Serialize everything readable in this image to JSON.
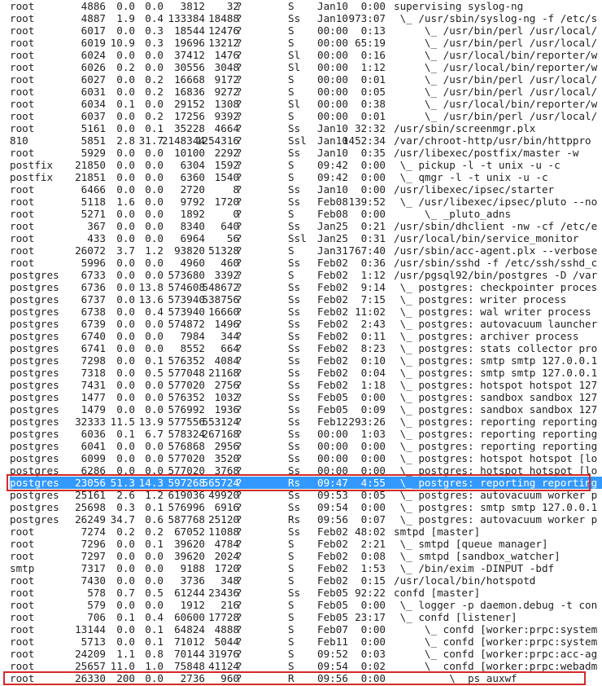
{
  "process_list": {
    "selected_pid": "23056",
    "rows": [
      {
        "user": "root",
        "pid": "4886",
        "cpu": "0.0",
        "mem": "0.0",
        "vsz": "3812",
        "rss": "32",
        "tty": "?",
        "stat": "S",
        "start": "Jan10",
        "time": "0:00",
        "cmd": "supervising syslog-ng"
      },
      {
        "user": "root",
        "pid": "4887",
        "cpu": "1.9",
        "mem": "0.4",
        "vsz": "133384",
        "rss": "18488",
        "tty": "?",
        "stat": "Ss",
        "start": "Jan10",
        "time": "973:07",
        "cmd": " \\_ /usr/sbin/syslog-ng -f /etc/s"
      },
      {
        "user": "root",
        "pid": "6017",
        "cpu": "0.0",
        "mem": "0.3",
        "vsz": "18544",
        "rss": "12476",
        "tty": "?",
        "stat": "S",
        "start": "00:00",
        "time": "0:13",
        "cmd": "     \\_ /usr/bin/perl /usr/local/"
      },
      {
        "user": "root",
        "pid": "6019",
        "cpu": "10.9",
        "mem": "0.3",
        "vsz": "19696",
        "rss": "13212",
        "tty": "?",
        "stat": "S",
        "start": "00:00",
        "time": "65:19",
        "cmd": "     \\_ /usr/bin/perl /usr/local/"
      },
      {
        "user": "root",
        "pid": "6024",
        "cpu": "0.0",
        "mem": "0.0",
        "vsz": "37412",
        "rss": "1476",
        "tty": "?",
        "stat": "Sl",
        "start": "00:00",
        "time": "0:16",
        "cmd": "     \\_ /usr/local/bin/reporter/w"
      },
      {
        "user": "root",
        "pid": "6026",
        "cpu": "0.2",
        "mem": "0.0",
        "vsz": "30556",
        "rss": "3048",
        "tty": "?",
        "stat": "Sl",
        "start": "00:00",
        "time": "1:12",
        "cmd": "     \\_ /usr/local/bin/reporter/w"
      },
      {
        "user": "root",
        "pid": "6027",
        "cpu": "0.0",
        "mem": "0.2",
        "vsz": "16668",
        "rss": "9172",
        "tty": "?",
        "stat": "S",
        "start": "00:00",
        "time": "0:01",
        "cmd": "     \\_ /usr/bin/perl /usr/local/"
      },
      {
        "user": "root",
        "pid": "6031",
        "cpu": "0.0",
        "mem": "0.2",
        "vsz": "16836",
        "rss": "9272",
        "tty": "?",
        "stat": "S",
        "start": "00:00",
        "time": "0:05",
        "cmd": "     \\_ /usr/bin/perl /usr/local/"
      },
      {
        "user": "root",
        "pid": "6034",
        "cpu": "0.1",
        "mem": "0.0",
        "vsz": "29152",
        "rss": "1308",
        "tty": "?",
        "stat": "Sl",
        "start": "00:00",
        "time": "0:38",
        "cmd": "     \\_ /usr/local/bin/reporter/w"
      },
      {
        "user": "root",
        "pid": "6037",
        "cpu": "0.0",
        "mem": "0.2",
        "vsz": "17256",
        "rss": "9392",
        "tty": "?",
        "stat": "S",
        "start": "00:00",
        "time": "0:01",
        "cmd": "     \\_ /usr/bin/perl /usr/local/"
      },
      {
        "user": "root",
        "pid": "5161",
        "cpu": "0.0",
        "mem": "0.1",
        "vsz": "35228",
        "rss": "4664",
        "tty": "?",
        "stat": "Ss",
        "start": "Jan10",
        "time": "32:32",
        "cmd": "/usr/sbin/screenmgr.plx"
      },
      {
        "user": "810",
        "pid": "5851",
        "cpu": "2.8",
        "mem": "31.7",
        "vsz": "2148344",
        "rss": "1254316",
        "tty": "?",
        "stat": "Ssl",
        "start": "Jan10",
        "time": "1452:34",
        "cmd": "/var/chroot-http/usr/bin/httppro"
      },
      {
        "user": "root",
        "pid": "5929",
        "cpu": "0.0",
        "mem": "0.0",
        "vsz": "10100",
        "rss": "2292",
        "tty": "?",
        "stat": "Ss",
        "start": "Jan10",
        "time": "0:35",
        "cmd": "/usr/libexec/postfix/master -w"
      },
      {
        "user": "postfix",
        "pid": "21850",
        "cpu": "0.0",
        "mem": "0.0",
        "vsz": "6304",
        "rss": "1592",
        "tty": "?",
        "stat": "S",
        "start": "09:42",
        "time": "0:00",
        "cmd": " \\_ pickup -l -t unix -u -c"
      },
      {
        "user": "postfix",
        "pid": "21851",
        "cpu": "0.0",
        "mem": "0.0",
        "vsz": "6360",
        "rss": "1540",
        "tty": "?",
        "stat": "S",
        "start": "09:42",
        "time": "0:00",
        "cmd": " \\_ qmgr -l -t unix -u -c"
      },
      {
        "user": "root",
        "pid": "6466",
        "cpu": "0.0",
        "mem": "0.0",
        "vsz": "2720",
        "rss": "8",
        "tty": "?",
        "stat": "Ss",
        "start": "Jan10",
        "time": "0:00",
        "cmd": "/usr/libexec/ipsec/starter"
      },
      {
        "user": "root",
        "pid": "5118",
        "cpu": "1.6",
        "mem": "0.0",
        "vsz": "9792",
        "rss": "1720",
        "tty": "?",
        "stat": "Ss",
        "start": "Feb08",
        "time": "139:52",
        "cmd": " \\_ /usr/libexec/ipsec/pluto --no"
      },
      {
        "user": "root",
        "pid": "5271",
        "cpu": "0.0",
        "mem": "0.0",
        "vsz": "1892",
        "rss": "0",
        "tty": "?",
        "stat": "S",
        "start": "Feb08",
        "time": "0:00",
        "cmd": "     \\_ _pluto_adns"
      },
      {
        "user": "root",
        "pid": "367",
        "cpu": "0.0",
        "mem": "0.0",
        "vsz": "8340",
        "rss": "640",
        "tty": "?",
        "stat": "Ss",
        "start": "Jan25",
        "time": "0:21",
        "cmd": "/usr/sbin/dhclient -nw -cf /etc/e"
      },
      {
        "user": "root",
        "pid": "433",
        "cpu": "0.0",
        "mem": "0.0",
        "vsz": "6964",
        "rss": "56",
        "tty": "?",
        "stat": "Ssl",
        "start": "Jan25",
        "time": "0:31",
        "cmd": "/usr/local/bin/service_monitor"
      },
      {
        "user": "root",
        "pid": "26072",
        "cpu": "3.7",
        "mem": "1.2",
        "vsz": "93820",
        "rss": "51328",
        "tty": "?",
        "stat": "S",
        "start": "Jan31",
        "time": "767:40",
        "cmd": "/usr/sbin/acc-agent.plx --verbose"
      },
      {
        "user": "root",
        "pid": "5996",
        "cpu": "0.0",
        "mem": "0.0",
        "vsz": "4960",
        "rss": "460",
        "tty": "?",
        "stat": "Ss",
        "start": "Feb02",
        "time": "0:36",
        "cmd": "/usr/sbin/sshd -f /etc/ssh/sshd_c"
      },
      {
        "user": "postgres",
        "pid": "6733",
        "cpu": "0.0",
        "mem": "0.0",
        "vsz": "573680",
        "rss": "3392",
        "tty": "?",
        "stat": "S",
        "start": "Feb02",
        "time": "1:12",
        "cmd": "/usr/pgsql92/bin/postgres -D /var"
      },
      {
        "user": "postgres",
        "pid": "6736",
        "cpu": "0.0",
        "mem": "13.8",
        "vsz": "574608",
        "rss": "548672",
        "tty": "?",
        "stat": "Ss",
        "start": "Feb02",
        "time": "9:14",
        "cmd": " \\_ postgres: checkpointer proces"
      },
      {
        "user": "postgres",
        "pid": "6737",
        "cpu": "0.0",
        "mem": "13.6",
        "vsz": "573940",
        "rss": "538756",
        "tty": "?",
        "stat": "Ss",
        "start": "Feb02",
        "time": "7:15",
        "cmd": " \\_ postgres: writer process"
      },
      {
        "user": "postgres",
        "pid": "6738",
        "cpu": "0.0",
        "mem": "0.4",
        "vsz": "573940",
        "rss": "16660",
        "tty": "?",
        "stat": "Ss",
        "start": "Feb02",
        "time": "11:02",
        "cmd": " \\_ postgres: wal writer process"
      },
      {
        "user": "postgres",
        "pid": "6739",
        "cpu": "0.0",
        "mem": "0.0",
        "vsz": "574872",
        "rss": "1496",
        "tty": "?",
        "stat": "Ss",
        "start": "Feb02",
        "time": "2:43",
        "cmd": " \\_ postgres: autovacuum launcher"
      },
      {
        "user": "postgres",
        "pid": "6740",
        "cpu": "0.0",
        "mem": "0.0",
        "vsz": "7984",
        "rss": "344",
        "tty": "?",
        "stat": "Ss",
        "start": "Feb02",
        "time": "0:11",
        "cmd": " \\_ postgres: archiver process"
      },
      {
        "user": "postgres",
        "pid": "6741",
        "cpu": "0.0",
        "mem": "0.0",
        "vsz": "8552",
        "rss": "664",
        "tty": "?",
        "stat": "Ss",
        "start": "Feb02",
        "time": "8:23",
        "cmd": " \\_ postgres: stats collector pro"
      },
      {
        "user": "postgres",
        "pid": "7298",
        "cpu": "0.0",
        "mem": "0.1",
        "vsz": "576352",
        "rss": "4084",
        "tty": "?",
        "stat": "Ss",
        "start": "Feb02",
        "time": "0:10",
        "cmd": " \\_ postgres: smtp smtp 127.0.0.1"
      },
      {
        "user": "postgres",
        "pid": "7318",
        "cpu": "0.0",
        "mem": "0.5",
        "vsz": "577048",
        "rss": "21168",
        "tty": "?",
        "stat": "Ss",
        "start": "Feb02",
        "time": "0:04",
        "cmd": " \\_ postgres: smtp smtp 127.0.0.1"
      },
      {
        "user": "postgres",
        "pid": "7431",
        "cpu": "0.0",
        "mem": "0.0",
        "vsz": "577020",
        "rss": "2756",
        "tty": "?",
        "stat": "Ss",
        "start": "Feb02",
        "time": "1:18",
        "cmd": " \\_ postgres: hotspot hotspot 127"
      },
      {
        "user": "postgres",
        "pid": "1477",
        "cpu": "0.0",
        "mem": "0.0",
        "vsz": "576352",
        "rss": "1032",
        "tty": "?",
        "stat": "Ss",
        "start": "Feb05",
        "time": "0:00",
        "cmd": " \\_ postgres: sandbox sandbox 127"
      },
      {
        "user": "postgres",
        "pid": "1479",
        "cpu": "0.0",
        "mem": "0.0",
        "vsz": "576992",
        "rss": "1936",
        "tty": "?",
        "stat": "Ss",
        "start": "Feb05",
        "time": "0:09",
        "cmd": " \\_ postgres: sandbox sandbox 127"
      },
      {
        "user": "postgres",
        "pid": "32333",
        "cpu": "11.5",
        "mem": "13.9",
        "vsz": "577556",
        "rss": "553124",
        "tty": "?",
        "stat": "Ss",
        "start": "Feb12",
        "time": "293:26",
        "cmd": " \\_ postgres: reporting reporting"
      },
      {
        "user": "postgres",
        "pid": "6036",
        "cpu": "0.1",
        "mem": "6.7",
        "vsz": "578324",
        "rss": "267168",
        "tty": "?",
        "stat": "Ss",
        "start": "00:00",
        "time": "1:03",
        "cmd": " \\_ postgres: reporting reporting"
      },
      {
        "user": "postgres",
        "pid": "6041",
        "cpu": "0.0",
        "mem": "0.0",
        "vsz": "576868",
        "rss": "2956",
        "tty": "?",
        "stat": "Ss",
        "start": "00:00",
        "time": "0:00",
        "cmd": " \\_ postgres: reporting reporting"
      },
      {
        "user": "postgres",
        "pid": "6099",
        "cpu": "0.0",
        "mem": "0.0",
        "vsz": "577020",
        "rss": "3520",
        "tty": "?",
        "stat": "Ss",
        "start": "00:00",
        "time": "0:00",
        "cmd": " \\_ postgres: hotspot hotspot [lo"
      },
      {
        "user": "postgres",
        "pid": "6286",
        "cpu": "0.0",
        "mem": "0.0",
        "vsz": "577020",
        "rss": "3768",
        "tty": "?",
        "stat": "Ss",
        "start": "00:00",
        "time": "0:00",
        "cmd": " \\_ postgres: hotspot hotspot [lo"
      },
      {
        "user": "postgres",
        "pid": "23056",
        "cpu": "51.3",
        "mem": "14.3",
        "vsz": "597268",
        "rss": "565724",
        "tty": "?",
        "stat": "Rs",
        "start": "09:47",
        "time": "4:55",
        "cmd": " \\_ postgres: reporting reporting"
      },
      {
        "user": "postgres",
        "pid": "25161",
        "cpu": "2.6",
        "mem": "1.2",
        "vsz": "619036",
        "rss": "49920",
        "tty": "?",
        "stat": "Ss",
        "start": "09:53",
        "time": "0:05",
        "cmd": " \\_ postgres: autovacuum worker p"
      },
      {
        "user": "postgres",
        "pid": "25698",
        "cpu": "0.3",
        "mem": "0.1",
        "vsz": "576996",
        "rss": "6916",
        "tty": "?",
        "stat": "Ss",
        "start": "09:54",
        "time": "0:00",
        "cmd": " \\_ postgres: smtp smtp 127.0.0.1"
      },
      {
        "user": "postgres",
        "pid": "26249",
        "cpu": "34.7",
        "mem": "0.6",
        "vsz": "587768",
        "rss": "25120",
        "tty": "?",
        "stat": "Rs",
        "start": "09:56",
        "time": "0:07",
        "cmd": " \\_ postgres: autovacuum worker p"
      },
      {
        "user": "root",
        "pid": "7274",
        "cpu": "0.2",
        "mem": "0.2",
        "vsz": "67052",
        "rss": "11088",
        "tty": "?",
        "stat": "Ss",
        "start": "Feb02",
        "time": "48:02",
        "cmd": "smtpd [master]"
      },
      {
        "user": "root",
        "pid": "7296",
        "cpu": "0.0",
        "mem": "0.1",
        "vsz": "39620",
        "rss": "4784",
        "tty": "?",
        "stat": "S",
        "start": "Feb02",
        "time": "2:21",
        "cmd": " \\_ smtpd [queue manager]"
      },
      {
        "user": "root",
        "pid": "7297",
        "cpu": "0.0",
        "mem": "0.0",
        "vsz": "39620",
        "rss": "2024",
        "tty": "?",
        "stat": "S",
        "start": "Feb02",
        "time": "0:08",
        "cmd": " \\_ smtpd [sandbox_watcher]"
      },
      {
        "user": "smtp",
        "pid": "7317",
        "cpu": "0.0",
        "mem": "0.0",
        "vsz": "9188",
        "rss": "1720",
        "tty": "?",
        "stat": "S",
        "start": "Feb02",
        "time": "1:53",
        "cmd": " \\_ /bin/exim -DINPUT -bdf"
      },
      {
        "user": "root",
        "pid": "7430",
        "cpu": "0.0",
        "mem": "0.0",
        "vsz": "3736",
        "rss": "348",
        "tty": "?",
        "stat": "S",
        "start": "Feb02",
        "time": "0:15",
        "cmd": "/usr/local/bin/hotspotd"
      },
      {
        "user": "root",
        "pid": "578",
        "cpu": "0.7",
        "mem": "0.5",
        "vsz": "61244",
        "rss": "23436",
        "tty": "?",
        "stat": "Ss",
        "start": "Feb05",
        "time": "92:22",
        "cmd": "confd [master]"
      },
      {
        "user": "root",
        "pid": "579",
        "cpu": "0.0",
        "mem": "0.0",
        "vsz": "1912",
        "rss": "216",
        "tty": "?",
        "stat": "S",
        "start": "Feb05",
        "time": "0:00",
        "cmd": " \\_ logger -p daemon.debug -t con"
      },
      {
        "user": "root",
        "pid": "706",
        "cpu": "0.1",
        "mem": "0.4",
        "vsz": "60600",
        "rss": "17728",
        "tty": "?",
        "stat": "S",
        "start": "Feb05",
        "time": "23:17",
        "cmd": " \\_ confd [listener]"
      },
      {
        "user": "root",
        "pid": "13144",
        "cpu": "0.0",
        "mem": "0.1",
        "vsz": "64824",
        "rss": "4888",
        "tty": "?",
        "stat": "S",
        "start": "Feb07",
        "time": "0:00",
        "cmd": "     \\_ confd [worker:prpc:system"
      },
      {
        "user": "root",
        "pid": "5713",
        "cpu": "0.0",
        "mem": "0.1",
        "vsz": "71012",
        "rss": "5044",
        "tty": "?",
        "stat": "S",
        "start": "Feb11",
        "time": "0:00",
        "cmd": "     \\_ confd [worker:prpc:system"
      },
      {
        "user": "root",
        "pid": "24209",
        "cpu": "1.1",
        "mem": "0.8",
        "vsz": "70144",
        "rss": "31976",
        "tty": "?",
        "stat": "S",
        "start": "09:52",
        "time": "0:03",
        "cmd": "     \\_ confd [worker:prpc:acc-ag"
      },
      {
        "user": "root",
        "pid": "25657",
        "cpu": "11.0",
        "mem": "1.0",
        "vsz": "75848",
        "rss": "41124",
        "tty": "?",
        "stat": "S",
        "start": "09:54",
        "time": "0:02",
        "cmd": "     \\_ confd [worker:prpc:webadm"
      },
      {
        "user": "root",
        "pid": "26330",
        "cpu": "200",
        "mem": "0.0",
        "vsz": "2736",
        "rss": "960",
        "tty": "?",
        "stat": "R",
        "start": "09:56",
        "time": "0:00",
        "cmd": "         \\_ ps auxwf"
      }
    ]
  }
}
